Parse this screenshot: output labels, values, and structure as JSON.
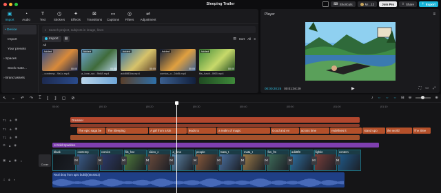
{
  "window": {
    "title": "Sleeping Trailer",
    "shortcuts": "Shortcuts",
    "account": "Mi...12",
    "join": "Join Pro",
    "share": "Share",
    "export": "Export",
    "traffic": [
      "#ff5f57",
      "#febc2e",
      "#28c840"
    ]
  },
  "media_tabs": [
    {
      "label": "Import",
      "glyph": "▣"
    },
    {
      "label": "Audio",
      "glyph": "◔"
    },
    {
      "label": "Text",
      "glyph": "T"
    },
    {
      "label": "Stickers",
      "glyph": "◷"
    },
    {
      "label": "Effects",
      "glyph": "✦"
    },
    {
      "label": "Transitions",
      "glyph": "⊠"
    },
    {
      "label": "Captions",
      "glyph": "▭"
    },
    {
      "label": "Filters",
      "glyph": "◎"
    },
    {
      "label": "Adjustment",
      "glyph": "⇌"
    }
  ],
  "sidebar": {
    "items": [
      "• Device",
      "Import",
      "Your presets",
      "› Spaces",
      "Stock mate...",
      "› Brand assets"
    ]
  },
  "media": {
    "search_placeholder": "Search project, subjects in image, lines",
    "import_label": "Import",
    "sort_label": "Sort",
    "all_filter": "All",
    "all_label": "All",
    "added_badge": "Added",
    "files": [
      {
        "name": "...contemp...9a1c.mp4",
        "duration": "00:05",
        "colors": [
          "#2a4b8c",
          "#d98a3a",
          "#1d2a4f"
        ]
      },
      {
        "name": "a_lone_wo...9b68.mp4",
        "duration": "00:05",
        "colors": [
          "#6fa6d8",
          "#3f6b3a",
          "#b9d4e8"
        ]
      },
      {
        "name": "add8f83ba.mp4",
        "duration": "00:05",
        "colors": [
          "#2e6fa8",
          "#d7c36a",
          "#5a3f2a"
        ]
      },
      {
        "name": "comics_o...2dd5.mp4",
        "duration": "00:05",
        "colors": [
          "#12203d",
          "#e0a040",
          "#3b5f8f"
        ]
      },
      {
        "name": "fils_hacit...0f65.mp4",
        "duration": "00:05",
        "colors": [
          "#3f8a3a",
          "#c7d96a",
          "#1f4a22"
        ]
      }
    ]
  },
  "player": {
    "title": "Player",
    "current_time": "00:00:20:25",
    "total_time": "00:01:04:29",
    "play_glyph": "▶",
    "menu_glyph": "≡"
  },
  "timeline": {
    "ruler": [
      "00:00",
      "|00:10",
      "|00:20",
      "|00:30",
      "|00:40",
      "|00:50",
      "|01:00",
      "|01:10"
    ],
    "tools": [
      "↖",
      "⌄",
      "↶",
      "↷",
      "⌶",
      "⟦",
      "⟧",
      "▢",
      "⊘"
    ],
    "cover_label": "Cover",
    "effect_track": {
      "label": "Dreamer",
      "color": "#b1472e"
    },
    "text_track_1": [
      {
        "text": "The epic saga be",
        "x": 0.064
      },
      {
        "text": "The Sleeping",
        "x": 0.14
      },
      {
        "text": "A girl from a kin",
        "x": 0.252
      },
      {
        "text": "leads to",
        "x": 0.352
      },
      {
        "text": "a realm of magic",
        "x": 0.43
      },
      {
        "text": "Good and ev",
        "x": 0.57
      },
      {
        "text": "across time",
        "x": 0.645
      },
      {
        "text": "redefines it",
        "x": 0.725
      },
      {
        "text": "stand upo",
        "x": 0.81
      },
      {
        "text": "the world",
        "x": 0.87
      },
      {
        "text": "The Slee",
        "x": 0.94
      }
    ],
    "adjust_track": {
      "label": "Gold Sparkles",
      "color": "#7f3fb0"
    },
    "video_clips": [
      {
        "label": "black",
        "color": "#111418"
      },
      {
        "label": "contemp",
        "color": "#3a5c8a"
      },
      {
        "label": "comics",
        "color": "#2d3b6a"
      },
      {
        "label": "fils_hat",
        "color": "#4f7a3b"
      },
      {
        "label": "video_c",
        "color": "#6a4a3a"
      },
      {
        "label": "a_lone",
        "color": "#5d86a8"
      },
      {
        "label": "people",
        "color": "#8a5a3b"
      },
      {
        "label": "mata_t",
        "color": "#4a6f9e"
      },
      {
        "label": "mata_t",
        "color": "#9a7a48"
      },
      {
        "label": "fos_fm",
        "color": "#3f6d5a"
      },
      {
        "label": "add8f8",
        "color": "#2f6fa0"
      },
      {
        "label": "fightin",
        "color": "#7a3f3a"
      },
      {
        "label": "contem",
        "color": "#1f5a8a"
      }
    ],
    "audio_track": {
      "label": "Real drop from apio build(s)844032)",
      "color": "#1f3f86"
    }
  }
}
